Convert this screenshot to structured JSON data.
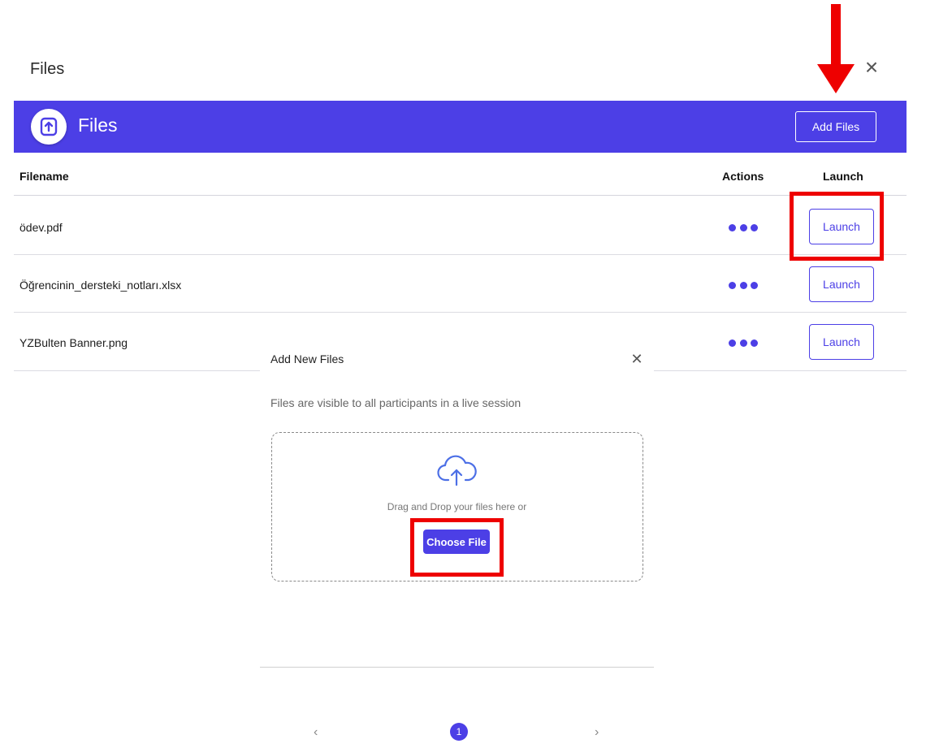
{
  "panel": {
    "title": "Files",
    "close_icon": "close-icon"
  },
  "header": {
    "icon": "file-upload-icon",
    "title": "Files",
    "add_files_label": "Add Files",
    "background_color": "#4c3fe6"
  },
  "table": {
    "columns": {
      "filename": "Filename",
      "actions": "Actions",
      "launch": "Launch"
    },
    "rows": [
      {
        "filename": "ödev.pdf",
        "actions_icon": "more-dots-icon",
        "launch_label": "Launch"
      },
      {
        "filename": "Öğrencinin_dersteki_notları.xlsx",
        "actions_icon": "more-dots-icon",
        "launch_label": "Launch"
      },
      {
        "filename": "YZBulten Banner.png",
        "actions_icon": "more-dots-icon",
        "launch_label": "Launch"
      }
    ]
  },
  "modal": {
    "title": "Add New Files",
    "close_icon": "close-icon",
    "description": "Files are visible to all participants in a live session",
    "dropzone": {
      "icon": "cloud-upload-icon",
      "text": "Drag and Drop your files here or",
      "choose_label": "Choose File"
    }
  },
  "pagination": {
    "prev_icon": "chevron-left-icon",
    "current_page": "1",
    "next_icon": "chevron-right-icon"
  },
  "annotations": {
    "color": "#ee0000",
    "arrow": "red-down-arrow"
  }
}
